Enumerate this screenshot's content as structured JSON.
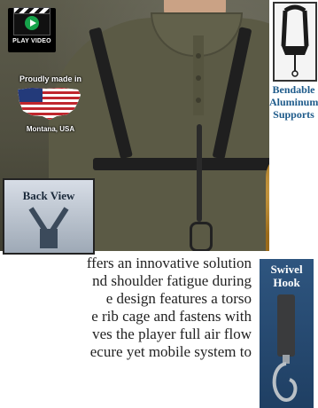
{
  "video": {
    "label": "PLAY VIDEO"
  },
  "origin": {
    "made_in": "Proudly made in",
    "state": "Montana, USA"
  },
  "features": {
    "supports_line1": "Bendable",
    "supports_line2": "Aluminum",
    "supports_line3": "Supports"
  },
  "back_view": {
    "label": "Back View"
  },
  "swivel": {
    "line1": "Swivel",
    "line2": "Hook"
  },
  "description": {
    "lines": [
      "ffers an innovative solution",
      "nd shoulder fatigue during",
      "e design features a torso",
      "e rib cage and fastens with",
      "ves the player full air flow",
      "ecure yet mobile system to"
    ]
  },
  "colors": {
    "text_blue": "#1d5a8a",
    "swivel_bg": "#2e557f",
    "shirt": "#5b5a45"
  }
}
